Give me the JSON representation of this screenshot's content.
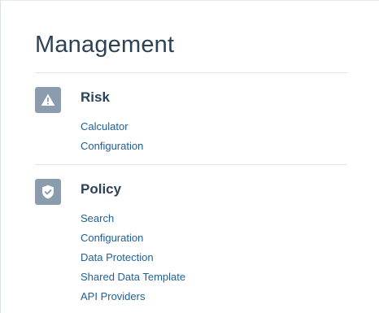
{
  "page": {
    "title": "Management"
  },
  "sections": [
    {
      "title": "Risk",
      "icon": "warning-icon",
      "links": [
        "Calculator",
        "Configuration"
      ]
    },
    {
      "title": "Policy",
      "icon": "shield-check-icon",
      "links": [
        "Search",
        "Configuration",
        "Data Protection",
        "Shared Data Template",
        "API Providers"
      ]
    }
  ],
  "colors": {
    "text": "#2e4257",
    "link": "#1f5f97",
    "icon_bg": "#8b9cae",
    "divider": "#dfe4ea"
  }
}
